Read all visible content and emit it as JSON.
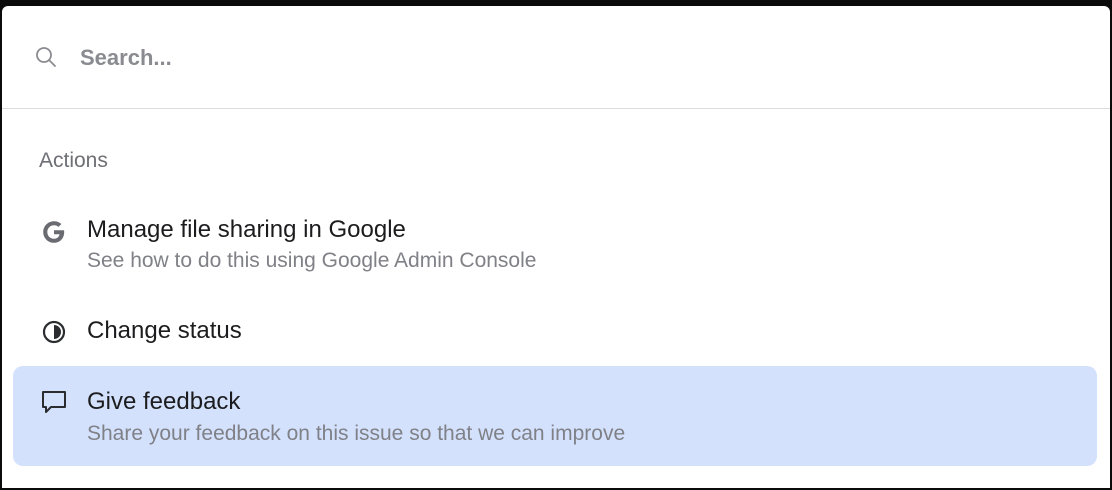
{
  "search": {
    "placeholder": "Search...",
    "value": ""
  },
  "section": {
    "title": "Actions"
  },
  "actions": [
    {
      "title": "Manage file sharing in Google",
      "subtitle": "See how to do this using Google Admin Console",
      "icon": "google-icon",
      "active": false
    },
    {
      "title": "Change status",
      "subtitle": "",
      "icon": "half-circle-status-icon",
      "active": false
    },
    {
      "title": "Give feedback",
      "subtitle": "Share your feedback on this issue so that we can improve",
      "icon": "speech-bubble-icon",
      "active": true
    }
  ],
  "colors": {
    "highlight": "#d3e1fd",
    "text_primary": "#1c1c1e",
    "text_secondary": "#808187",
    "divider": "#dcdcde"
  }
}
